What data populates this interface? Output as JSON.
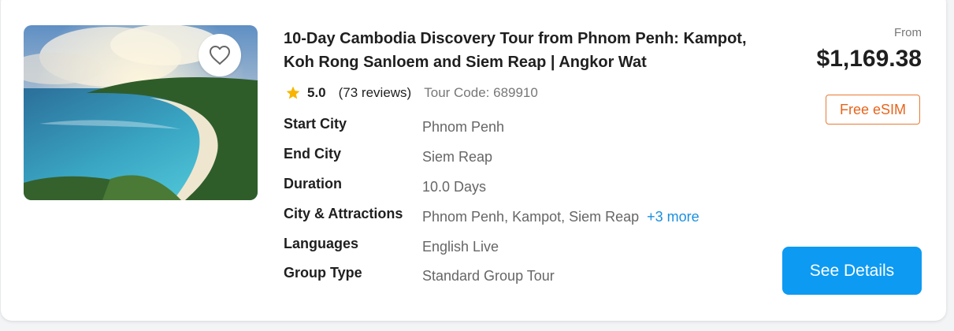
{
  "tour": {
    "title": "10-Day Cambodia Discovery Tour from Phnom Penh: Kampot, Koh Rong Sanloem and Siem Reap | Angkor Wat",
    "rating": "5.0",
    "reviews": "(73 reviews)",
    "tour_code": "Tour Code: 689910",
    "favorite_icon": "heart-outline-icon",
    "rating_icon": "star-icon"
  },
  "details": [
    {
      "label": "Start City",
      "value": "Phnom Penh"
    },
    {
      "label": "End City",
      "value": "Siem Reap"
    },
    {
      "label": "Duration",
      "value": "10.0 Days"
    },
    {
      "label": "City & Attractions",
      "value": "Phnom Penh, Kampot, Siem Reap",
      "more": "+3 more"
    },
    {
      "label": "Languages",
      "value": "English Live"
    },
    {
      "label": "Group Type",
      "value": "Standard Group Tour"
    }
  ],
  "pricing": {
    "from_label": "From",
    "price": "$1,169.38",
    "badge": "Free eSIM",
    "button": "See Details"
  },
  "colors": {
    "accent": "#0d9af2",
    "star": "#f7b500",
    "badge": "#e8641b",
    "link": "#1a8fe0"
  }
}
